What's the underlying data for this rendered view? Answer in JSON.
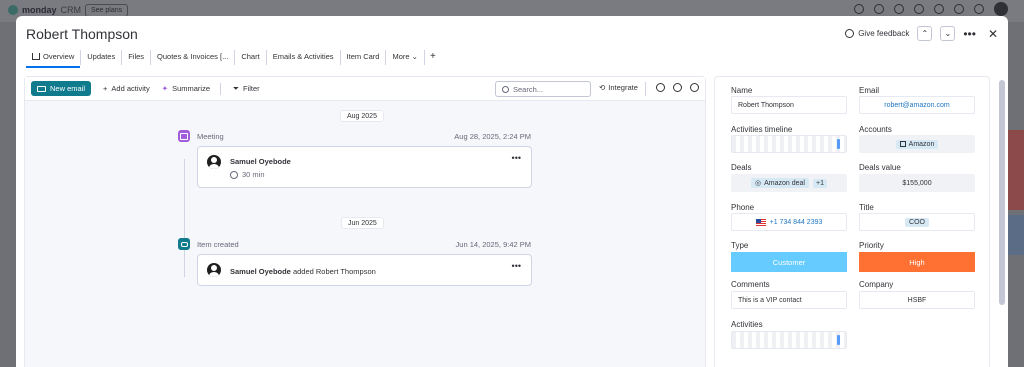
{
  "background": {
    "app_name": "monday",
    "app_suffix": "CRM",
    "see_plans": "See plans"
  },
  "modal": {
    "title": "Robert Thompson",
    "feedback_label": "Give feedback",
    "tabs": [
      {
        "label": "Overview",
        "active": true
      },
      {
        "label": "Updates"
      },
      {
        "label": "Files"
      },
      {
        "label": "Quotes & Invoices [..."
      },
      {
        "label": "Chart"
      },
      {
        "label": "Emails & Activities"
      },
      {
        "label": "Item Card"
      },
      {
        "label": "More"
      }
    ],
    "tab_add": "+"
  },
  "toolbar": {
    "new_email": "New email",
    "add_activity": "Add activity",
    "summarize": "Summarize",
    "filter": "Filter",
    "search_placeholder": "Search...",
    "integrate": "Integrate"
  },
  "timeline": {
    "groups": [
      {
        "date": "Aug 2025",
        "event_type": "Meeting",
        "event_date": "Aug 28, 2025, 2:24 PM",
        "person": "Samuel Oyebode",
        "duration": "30 min"
      },
      {
        "date": "Jun 2025",
        "event_type": "Item created",
        "event_date": "Jun 14, 2025, 9:42 PM",
        "person": "Samuel Oyebode",
        "action": "added Robert Thompson"
      }
    ]
  },
  "fields": {
    "name": {
      "label": "Name",
      "value": "Robert Thompson"
    },
    "email": {
      "label": "Email",
      "value": "robert@amazon.com"
    },
    "activities_timeline": {
      "label": "Activities timeline"
    },
    "accounts": {
      "label": "Accounts",
      "value": "Amazon"
    },
    "deals": {
      "label": "Deals",
      "value": "Amazon deal",
      "extra": "+1"
    },
    "deals_value": {
      "label": "Deals value",
      "value": "$155,000"
    },
    "phone": {
      "label": "Phone",
      "value": "+1 734 844 2393"
    },
    "title": {
      "label": "Title",
      "value": "COO"
    },
    "type": {
      "label": "Type",
      "value": "Customer",
      "color": "#66ccff"
    },
    "priority": {
      "label": "Priority",
      "value": "High",
      "color": "#ff7033"
    },
    "comments": {
      "label": "Comments",
      "value": "This is a VIP contact"
    },
    "company": {
      "label": "Company",
      "value": "HSBF"
    },
    "activities": {
      "label": "Activities"
    }
  }
}
